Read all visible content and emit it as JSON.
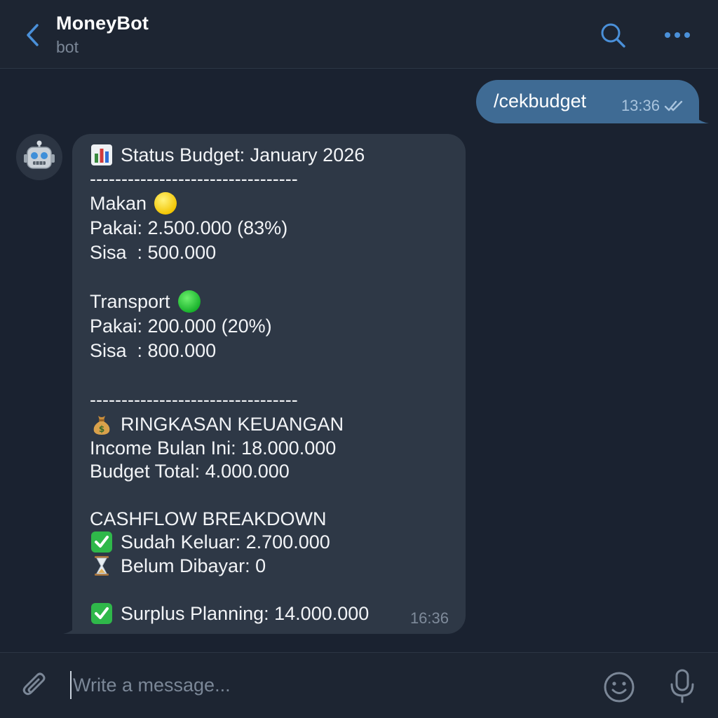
{
  "header": {
    "title": "MoneyBot",
    "subtitle": "bot",
    "back_icon": "chevron-left-icon",
    "search_icon": "search-icon",
    "more_icon": "more-horizontal-icon"
  },
  "messages": {
    "outgoing": {
      "text": "/cekbudget",
      "time": "13:36",
      "status_icon": "double-check-icon"
    },
    "incoming": {
      "avatar_icon": "robot-icon",
      "time": "16:36",
      "lines": [
        {
          "emoji": "bar-chart-icon",
          "text": "Status Budget: January 2026"
        },
        {
          "text": "---------------------------------"
        },
        {
          "text": "Makan",
          "emoji_after": "yellow-circle-icon"
        },
        {
          "text": "Pakai: 2.500.000 (83%)"
        },
        {
          "text": "Sisa  : 500.000"
        },
        {
          "text": "Transport",
          "emoji_after": "green-circle-icon"
        },
        {
          "text": "Pakai: 200.000 (20%)"
        },
        {
          "text": "Sisa  : 800.000"
        },
        {
          "text": "---------------------------------"
        },
        {
          "emoji": "money-bag-icon",
          "text": "RINGKASAN KEUANGAN"
        },
        {
          "text": "Income Bulan Ini: 18.000.000"
        },
        {
          "text": "Budget Total: 4.000.000"
        },
        {
          "text": "CASHFLOW BREAKDOWN"
        },
        {
          "emoji": "check-mark-icon",
          "text": "Sudah Keluar: 2.700.000"
        },
        {
          "emoji": "hourglass-icon",
          "text": "Belum Dibayar: 0"
        },
        {
          "emoji": "check-mark-icon",
          "text": "Surplus Planning: 14.000.000"
        }
      ]
    }
  },
  "composer": {
    "placeholder": "Write a message...",
    "value": "",
    "attach_icon": "paperclip-icon",
    "emoji_icon": "smiley-icon",
    "mic_icon": "microphone-icon"
  },
  "colors": {
    "background": "#1a2230",
    "header": "#1d2532",
    "accent": "#4a90d9",
    "outgoing_bubble": "#3f6b94",
    "incoming_bubble": "#2e3846",
    "secondary_text": "#7b8797"
  }
}
